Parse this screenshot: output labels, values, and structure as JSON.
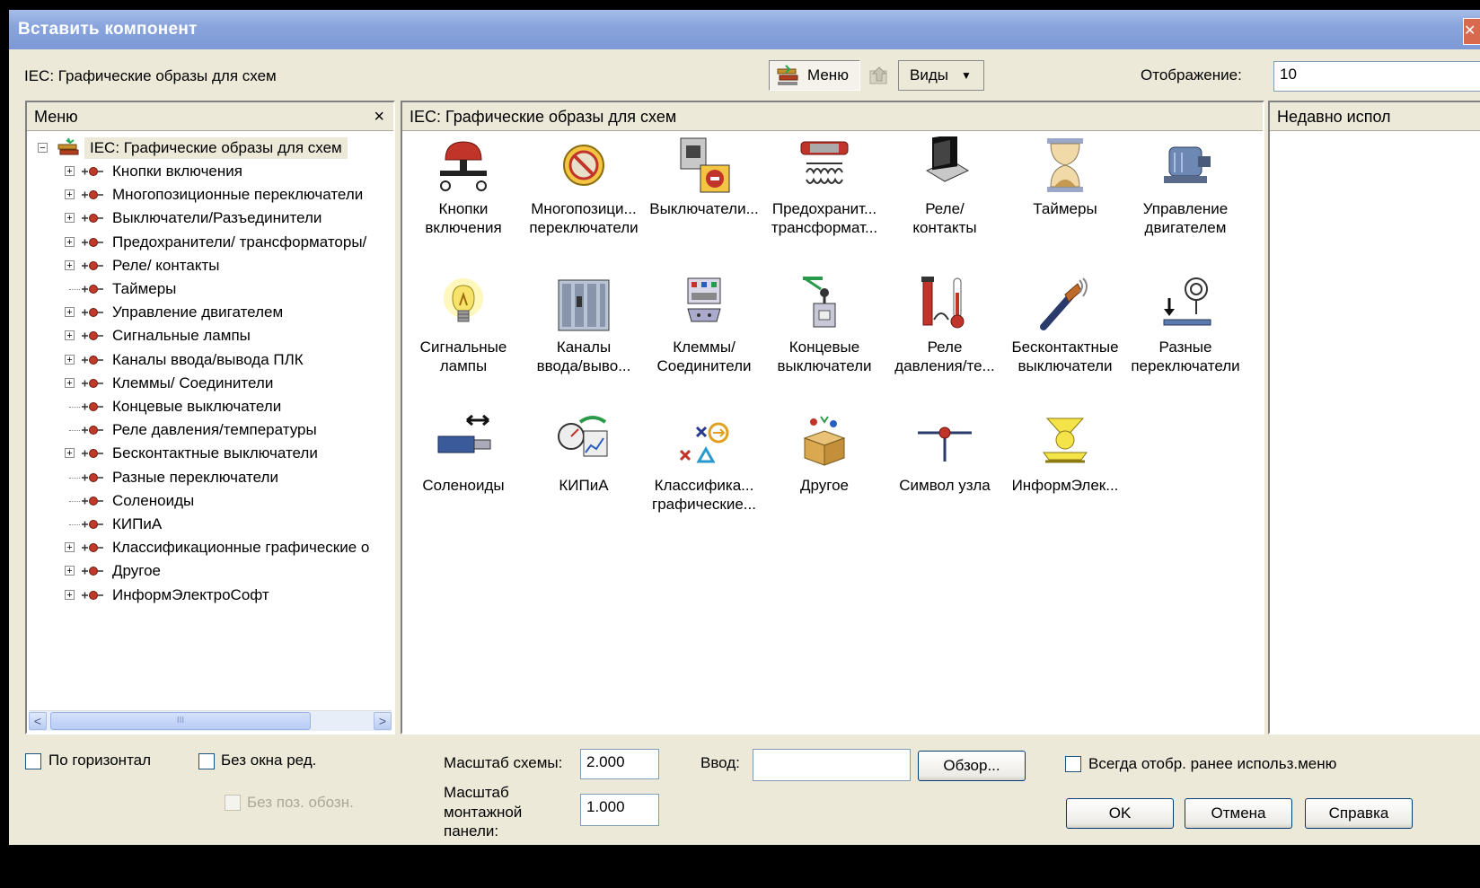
{
  "window": {
    "title": "Вставить компонент"
  },
  "top": {
    "library_label": "IEC: Графические образы для схем",
    "menu_button": "Меню",
    "views_button": "Виды",
    "display_label": "Отображение:",
    "display_value": "10"
  },
  "left_panel": {
    "header": "Меню",
    "close": "×",
    "root": "IEC: Графические образы для схем",
    "items": [
      {
        "label": "Кнопки включения",
        "expandable": true
      },
      {
        "label": "Многопозиционные переключатели",
        "expandable": true
      },
      {
        "label": "Выключатели/Разъединители",
        "expandable": true
      },
      {
        "label": "Предохранители/ трансформаторы/",
        "expandable": true
      },
      {
        "label": "Реле/ контакты",
        "expandable": true
      },
      {
        "label": "Таймеры",
        "expandable": false
      },
      {
        "label": "Управление двигателем",
        "expandable": true
      },
      {
        "label": "Сигнальные лампы",
        "expandable": true
      },
      {
        "label": "Каналы ввода/вывода ПЛК",
        "expandable": true
      },
      {
        "label": "Клеммы/ Соединители",
        "expandable": true
      },
      {
        "label": "Концевые выключатели",
        "expandable": false
      },
      {
        "label": "Реле давления/температуры",
        "expandable": false
      },
      {
        "label": "Бесконтактные выключатели",
        "expandable": true
      },
      {
        "label": "Разные переключатели",
        "expandable": false
      },
      {
        "label": "Соленоиды",
        "expandable": false
      },
      {
        "label": "КИПиА",
        "expandable": false
      },
      {
        "label": "Классификационные графические о",
        "expandable": true
      },
      {
        "label": "Другое",
        "expandable": true
      },
      {
        "label": "ИнформЭлектроСофт",
        "expandable": true
      }
    ],
    "scroll_thumb": "III"
  },
  "center_panel": {
    "header": "IEC: Графические образы для схем",
    "icons": [
      {
        "line1": "Кнопки",
        "line2": "включения",
        "icon": "pushbutton-icon"
      },
      {
        "line1": "Многопозици...",
        "line2": "переключатели",
        "icon": "selector-switch-icon"
      },
      {
        "line1": "Выключатели...",
        "line2": "",
        "icon": "disconnect-icon"
      },
      {
        "line1": "Предохранит...",
        "line2": "трансформат...",
        "icon": "fuse-transformer-icon"
      },
      {
        "line1": "Реле/",
        "line2": "контакты",
        "icon": "relay-icon"
      },
      {
        "line1": "Таймеры",
        "line2": "",
        "icon": "hourglass-icon"
      },
      {
        "line1": "Управление",
        "line2": "двигателем",
        "icon": "motor-icon"
      },
      {
        "line1": "Сигнальные",
        "line2": "лампы",
        "icon": "lamp-icon"
      },
      {
        "line1": "Каналы",
        "line2": "ввода/выво...",
        "icon": "plc-icon"
      },
      {
        "line1": "Клеммы/",
        "line2": "Соединители",
        "icon": "terminal-icon"
      },
      {
        "line1": "Концевые",
        "line2": "выключатели",
        "icon": "limit-switch-icon"
      },
      {
        "line1": "Реле",
        "line2": "давления/те...",
        "icon": "pressure-temp-icon"
      },
      {
        "line1": "Бесконтактные",
        "line2": "выключатели",
        "icon": "proximity-icon"
      },
      {
        "line1": "Разные",
        "line2": "переключатели",
        "icon": "misc-switch-icon"
      },
      {
        "line1": "Соленоиды",
        "line2": "",
        "icon": "solenoid-icon"
      },
      {
        "line1": "КИПиА",
        "line2": "",
        "icon": "instrument-icon"
      },
      {
        "line1": "Классифика...",
        "line2": "графические...",
        "icon": "classification-icon"
      },
      {
        "line1": "Другое",
        "line2": "",
        "icon": "box-icon"
      },
      {
        "line1": "Символ узла",
        "line2": "",
        "icon": "node-symbol-icon"
      },
      {
        "line1": "ИнформЭлек...",
        "line2": "",
        "icon": "informelektro-icon"
      }
    ]
  },
  "right_panel": {
    "header": "Недавно испол"
  },
  "bottom": {
    "horizontal_label": "По горизонтал",
    "no_edit_label": "Без окна ред.",
    "no_tag_label": "Без поз. обозн.",
    "scale_label": "Масштаб схемы:",
    "scale_value": "2.000",
    "panel_scale_line1": "Масштаб",
    "panel_scale_line2": "монтажной",
    "panel_scale_line3": "панели:",
    "panel_scale_value": "1.000",
    "input_label": "Ввод:",
    "input_value": "",
    "browse_button": "Обзор...",
    "always_show_label": "Всегда отобр. ранее использ.меню",
    "ok_button": "OK",
    "cancel_button": "Отмена",
    "help_button": "Справка"
  }
}
